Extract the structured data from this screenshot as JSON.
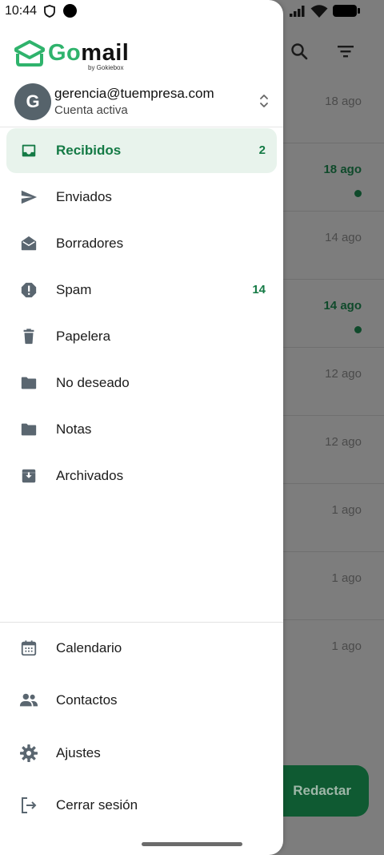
{
  "status_bar": {
    "time": "10:44"
  },
  "brand": {
    "name_go": "Go",
    "name_rest": "mail",
    "byline": "by Gokiebox",
    "accent": "#2fb36c"
  },
  "account": {
    "initial": "G",
    "email": "gerencia@tuempresa.com",
    "status": "Cuenta activa"
  },
  "folders": [
    {
      "label": "Recibidos",
      "icon": "inbox-icon",
      "count": "2",
      "active": true
    },
    {
      "label": "Enviados",
      "icon": "send-icon",
      "count": ""
    },
    {
      "label": "Borradores",
      "icon": "drafts-icon",
      "count": ""
    },
    {
      "label": "Spam",
      "icon": "spam-icon",
      "count": "14"
    },
    {
      "label": "Papelera",
      "icon": "trash-icon",
      "count": ""
    },
    {
      "label": "No deseado",
      "icon": "folder-icon",
      "count": ""
    },
    {
      "label": "Notas",
      "icon": "folder-icon",
      "count": ""
    },
    {
      "label": "Archivados",
      "icon": "archive-icon",
      "count": ""
    }
  ],
  "secondary": [
    {
      "label": "Calendario",
      "icon": "calendar-icon"
    },
    {
      "label": "Contactos",
      "icon": "contacts-icon"
    },
    {
      "label": "Ajustes",
      "icon": "gear-icon"
    },
    {
      "label": "Cerrar sesión",
      "icon": "logout-icon"
    }
  ],
  "background_list": {
    "dates": [
      "18 ago",
      "18 ago",
      "14 ago",
      "14 ago",
      "12 ago",
      "12 ago",
      "1 ago",
      "1 ago",
      "1 ago"
    ],
    "unread": [
      false,
      true,
      false,
      true,
      false,
      false,
      false,
      false,
      false
    ]
  },
  "fab": {
    "label": "Redactar"
  }
}
